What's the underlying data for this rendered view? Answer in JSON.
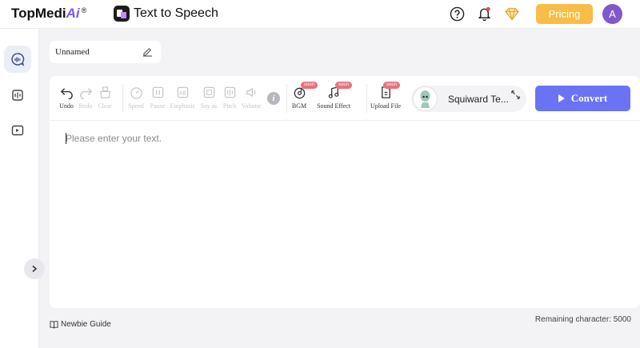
{
  "brand": {
    "name_prefix": "TopMedi",
    "name_ai": "Ai",
    "registered": "®"
  },
  "app": {
    "title": "Text to Speech"
  },
  "header": {
    "pricing_label": "Pricing",
    "avatar_initial": "A"
  },
  "project": {
    "name": "Unnamed"
  },
  "toolbar": {
    "undo": "Undo",
    "redo": "Redo",
    "clear": "Clear",
    "speed": "Speed",
    "pause": "Pause",
    "emphasis": "Emphasis",
    "say_as": "Say as",
    "pitch": "Pitch",
    "volume": "Volume",
    "bgm": "BGM",
    "sound_effect": "Sound Effect",
    "upload_file": "Upload File",
    "soon_badge": "soon"
  },
  "voice": {
    "name": "Squiward Te..."
  },
  "convert_label": "Convert",
  "editor": {
    "placeholder": "Please enter your text."
  },
  "footer": {
    "newbie_guide": "Newbie Guide",
    "remaining": "Remaining character: 5000"
  },
  "colors": {
    "accent": "#6b73f5",
    "pricing": "#f7bd47",
    "avatar": "#7f58c9",
    "badge": "#e8727a"
  }
}
